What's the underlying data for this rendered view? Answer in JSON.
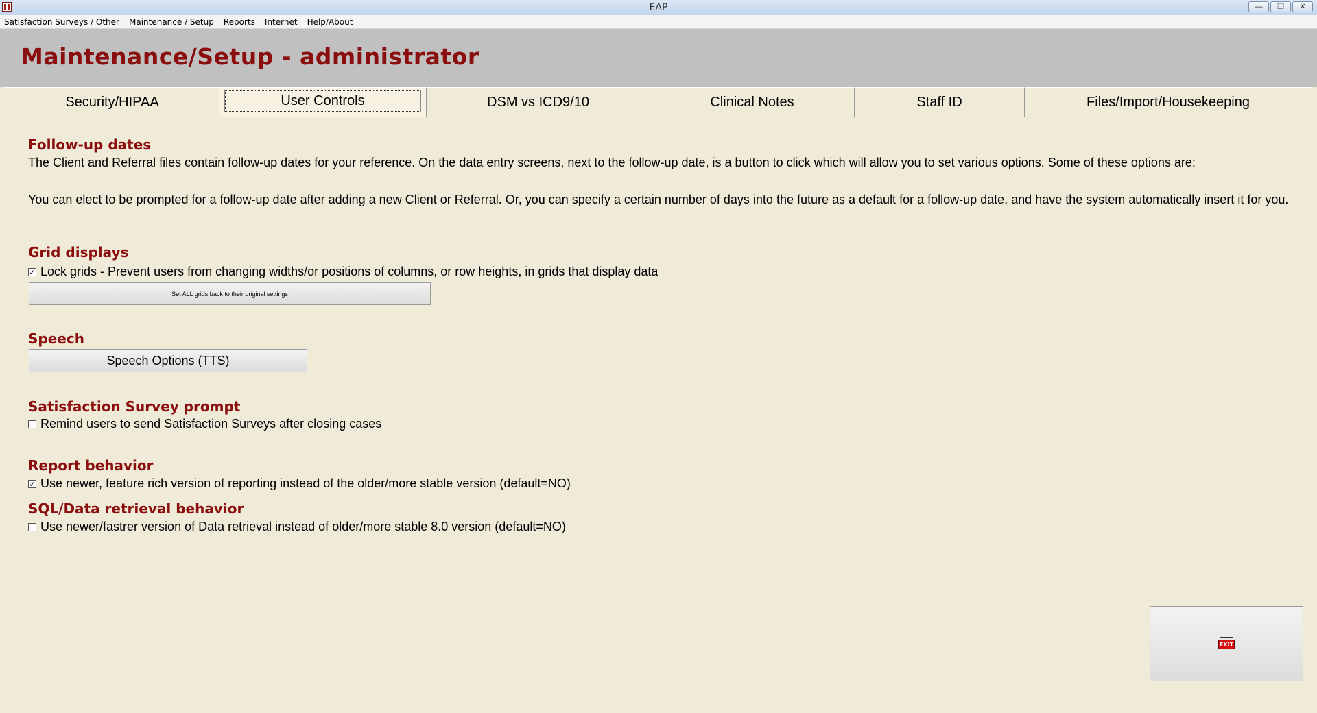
{
  "window": {
    "title": "EAP",
    "controls": [
      "—",
      "❐",
      "✕"
    ]
  },
  "menu": [
    "Satisfaction Surveys / Other",
    "Maintenance / Setup",
    "Reports",
    "Internet",
    "Help/About"
  ],
  "header": {
    "title": "Maintenance/Setup - administrator"
  },
  "tabs": [
    "Security/HIPAA",
    "User Controls",
    "DSM vs ICD9/10",
    "Clinical Notes",
    "Staff ID",
    "Files/Import/Housekeeping"
  ],
  "active_tab": "User Controls",
  "followup": {
    "title": "Follow-up dates",
    "para1": "The Client and Referral files contain follow-up dates for your reference.  On the data entry screens, next to the follow-up date, is a button to click which will allow you to set various options.  Some of these options are:",
    "para2": "You can elect to be prompted for a follow-up date after adding a new Client or Referral.  Or, you can specify a certain number of days into the future as a default for a follow-up date, and have the system automatically insert it for you."
  },
  "grid": {
    "title": "Grid displays",
    "lock_label": "Lock grids - Prevent users from changing widths/or positions of columns, or row heights, in grids that display data",
    "lock_checked": true,
    "reset_button": "Set ALL grids back to their original settings"
  },
  "speech": {
    "title": "Speech",
    "button": "Speech Options (TTS)"
  },
  "survey": {
    "title": "Satisfaction Survey prompt",
    "remind_label": "Remind users to send Satisfaction Surveys after closing cases",
    "remind_checked": false
  },
  "report": {
    "title": "Report behavior",
    "label": "Use newer, feature rich version of reporting instead of the older/more stable version (default=NO)",
    "checked": true
  },
  "sql": {
    "title": "SQL/Data retrieval behavior",
    "label": "Use newer/fastrer version of Data retrieval instead of older/more stable 8.0 version (default=NO)",
    "checked": false
  },
  "exit_button": {
    "icon": "exit-sign-icon",
    "label": "EXIT"
  },
  "colors": {
    "heading": "#8b0e0e",
    "background": "#f0ead8",
    "header": "#c0c0c0"
  }
}
